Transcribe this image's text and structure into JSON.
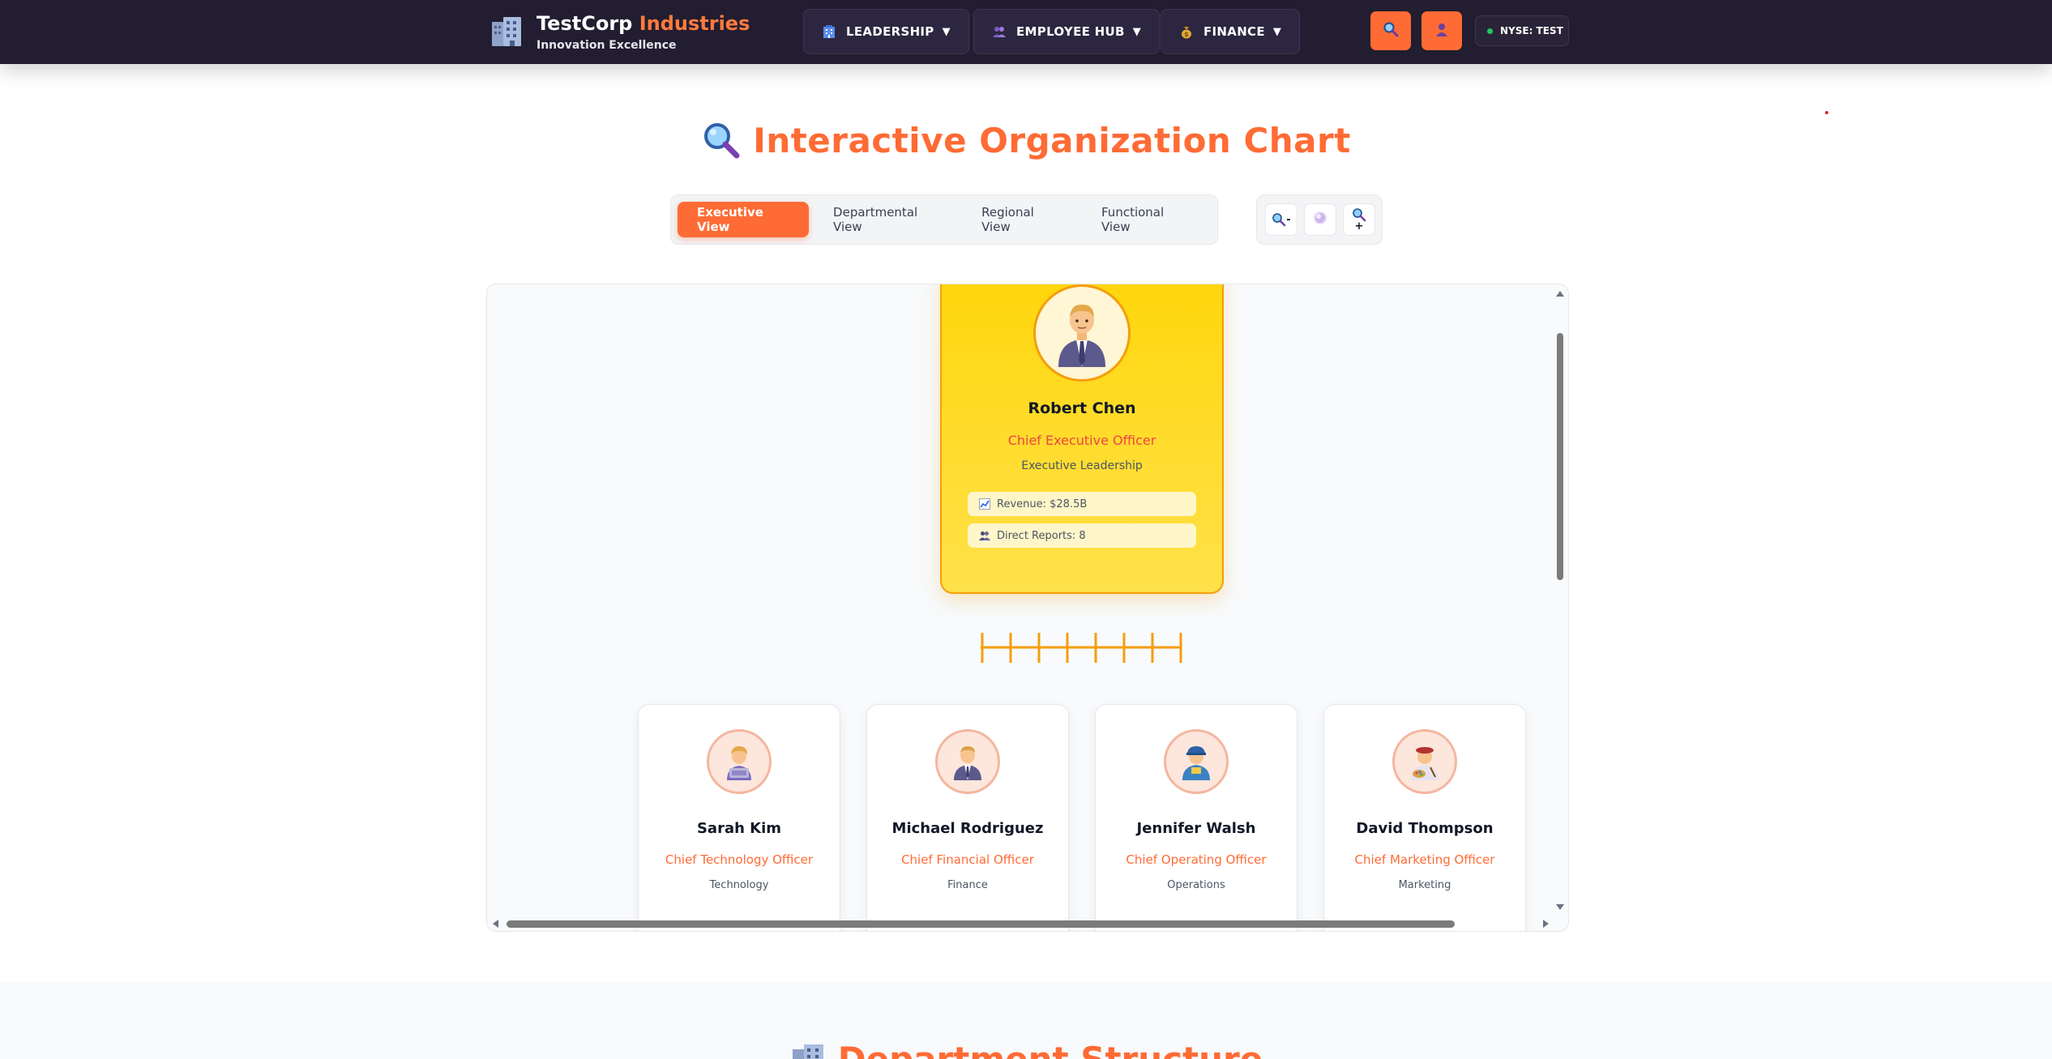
{
  "header": {
    "brand_name": "TestCorp",
    "brand_accent": "Industries",
    "brand_tagline": "Innovation Excellence",
    "nav": [
      {
        "label": "LEADERSHIP",
        "icon": "office-building-icon"
      },
      {
        "label": "EMPLOYEE HUB",
        "icon": "people-icon"
      },
      {
        "label": "FINANCE",
        "icon": "money-bag-icon"
      }
    ],
    "search_icon": "search-icon",
    "profile_icon": "user-icon",
    "ticker": "NYSE: TEST"
  },
  "page": {
    "title": "Interactive Organization Chart",
    "title_icon": "magnifier-icon"
  },
  "views": {
    "tabs": [
      "Executive View",
      "Departmental View",
      "Regional View",
      "Functional View"
    ],
    "active": "Executive View"
  },
  "zoom": {
    "out_label": "-",
    "in_label": "+"
  },
  "ceo": {
    "name": "Robert Chen",
    "title": "Chief Executive Officer",
    "department": "Executive Leadership",
    "metrics": [
      {
        "label": "Revenue: $28.5B",
        "icon": "chart-icon"
      },
      {
        "label": "Direct Reports: 8",
        "icon": "people-icon"
      }
    ]
  },
  "reports": [
    {
      "name": "Sarah Kim",
      "title": "Chief Technology Officer",
      "department": "Technology",
      "avatar": "technologist-icon"
    },
    {
      "name": "Michael Rodriguez",
      "title": "Chief Financial Officer",
      "department": "Finance",
      "avatar": "businessman-icon"
    },
    {
      "name": "Jennifer Walsh",
      "title": "Chief Operating Officer",
      "department": "Operations",
      "avatar": "worker-icon"
    },
    {
      "name": "David Thompson",
      "title": "Chief Marketing Officer",
      "department": "Marketing",
      "avatar": "artist-icon"
    }
  ],
  "next_section": {
    "title": "Department Structure"
  },
  "colors": {
    "accent": "#ff6b35",
    "nav_bg": "#221d30",
    "ceo_card": "#ffd60a",
    "connector": "#f59e0b"
  }
}
